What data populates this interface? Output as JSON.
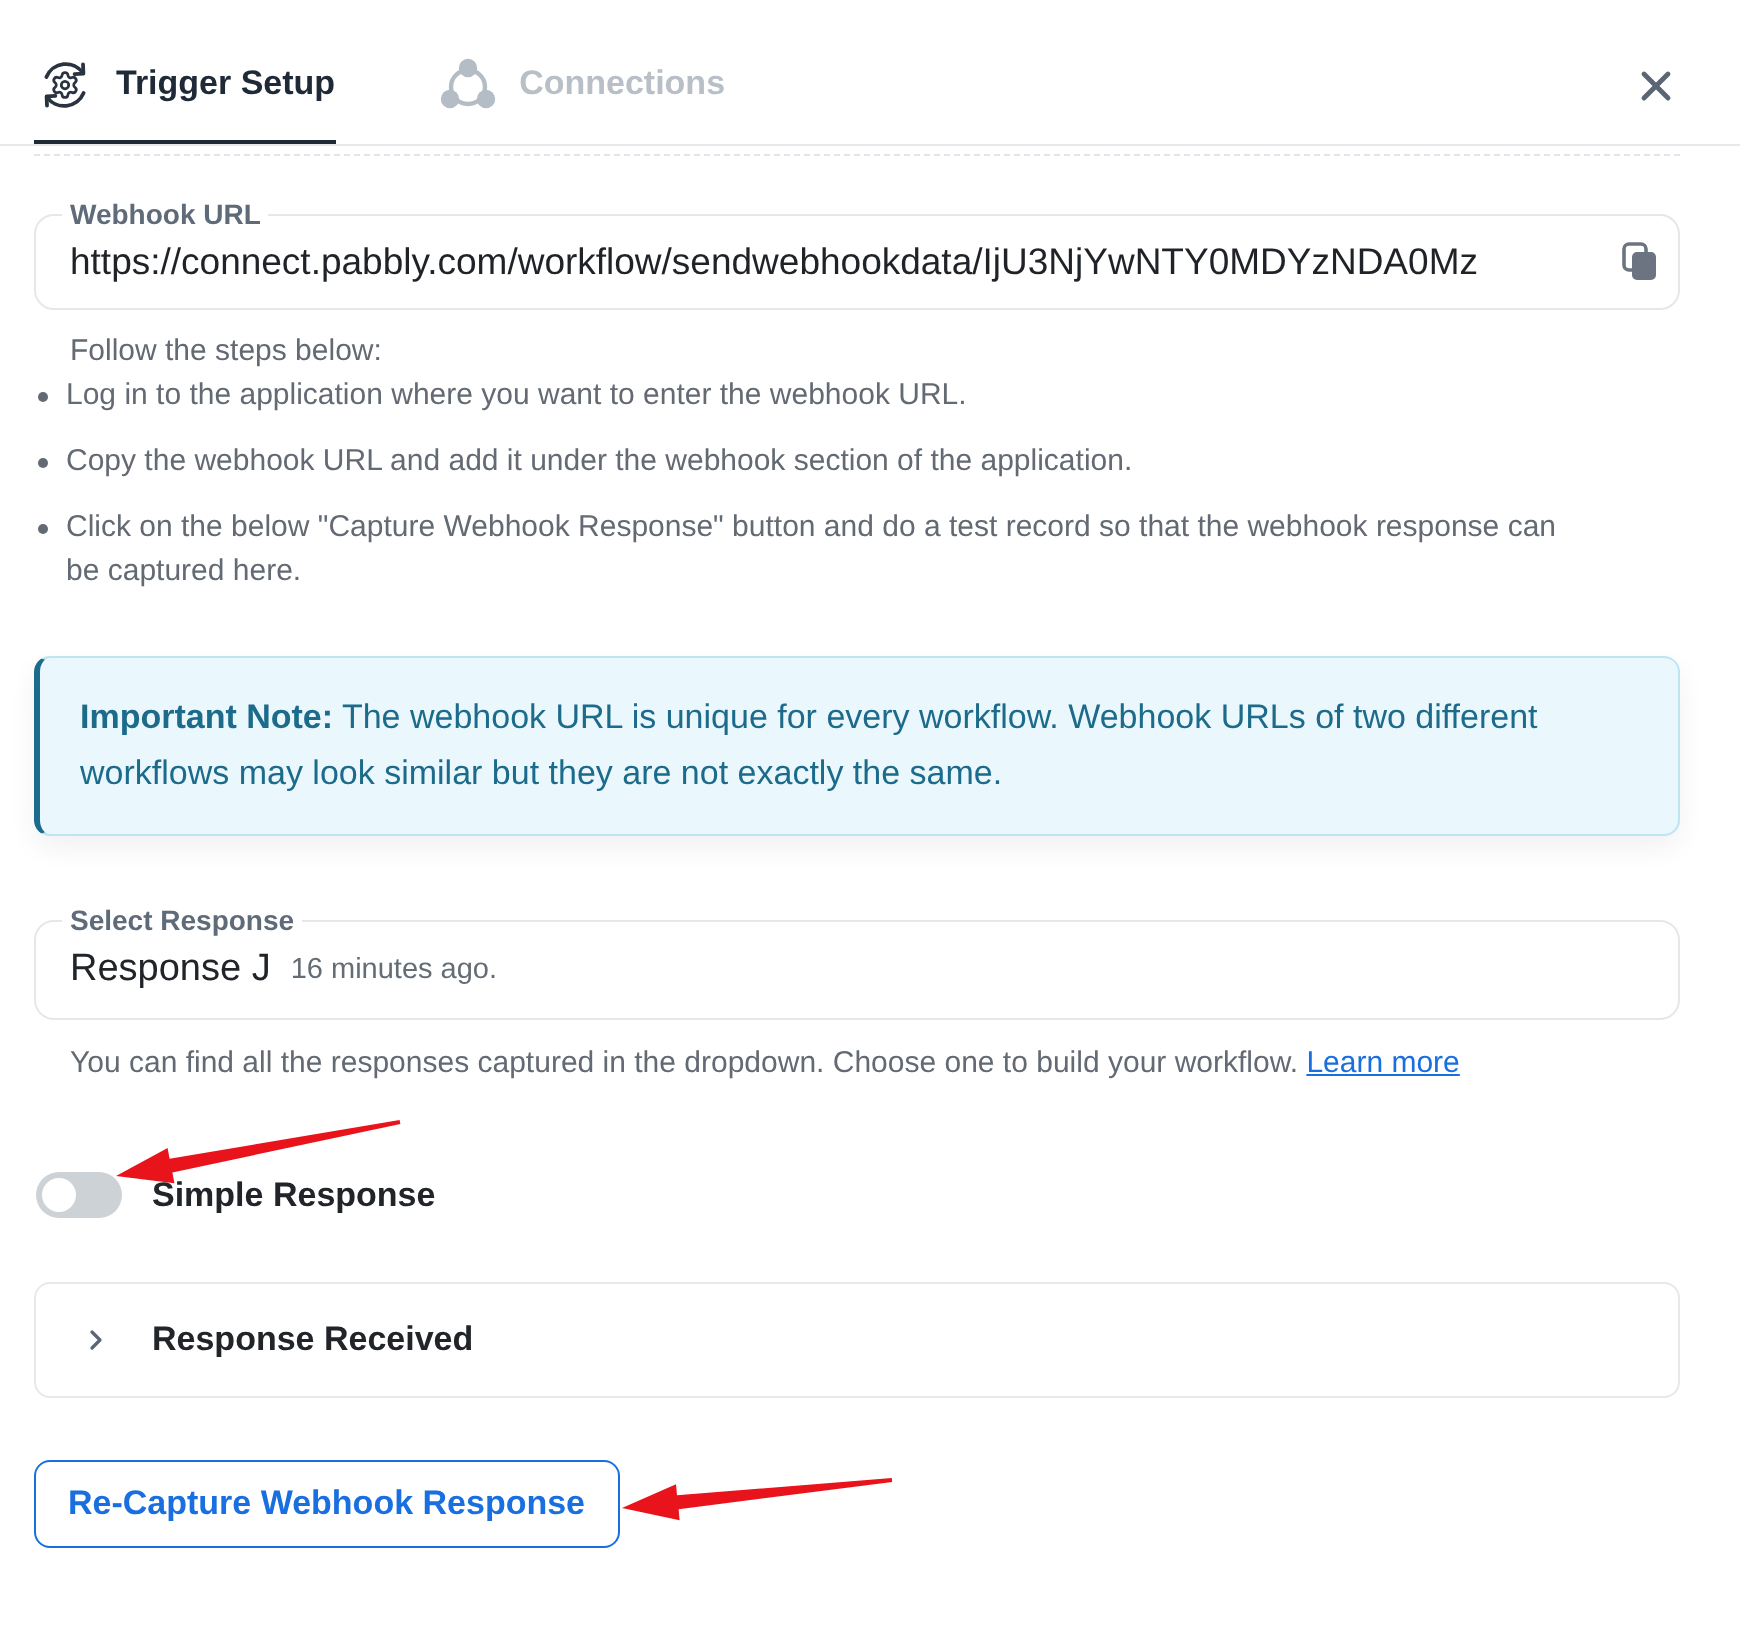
{
  "tabs": [
    {
      "label": "Trigger Setup",
      "selected": true,
      "kind": "trigger"
    },
    {
      "label": "Connections",
      "selected": false,
      "kind": "connection"
    }
  ],
  "webhook_url": {
    "label": "Webhook URL",
    "value": "https://connect.pabbly.com/workflow/sendwebhookdata/IjU3NjYwNTY0MDYzNDA0Mz"
  },
  "steps": {
    "intro": "Follow the steps below:",
    "items": [
      "Log in to the application where you want to enter the webhook URL.",
      "Copy the webhook URL and add it under the webhook section of the application.",
      "Click on the below \"Capture Webhook Response\" button and do a test record so that the webhook response can be captured here."
    ]
  },
  "note": {
    "text": "**Important Note:** The webhook URL is unique for every workflow. Webhook URLs of two different workflows may look similar but they are not exactly the same."
  },
  "select_response": {
    "label": "Select Response",
    "value": "Response J",
    "time": "16 minutes ago."
  },
  "helper": {
    "text": "You can find all the responses captured in the dropdown. Choose one to build your workflow.",
    "link": "Learn more"
  },
  "toggle": {
    "label": "Simple Response",
    "on": false
  },
  "accordion": {
    "title": "Response Received",
    "expanded": false
  },
  "button": {
    "label": "Re-Capture Webhook Response"
  }
}
